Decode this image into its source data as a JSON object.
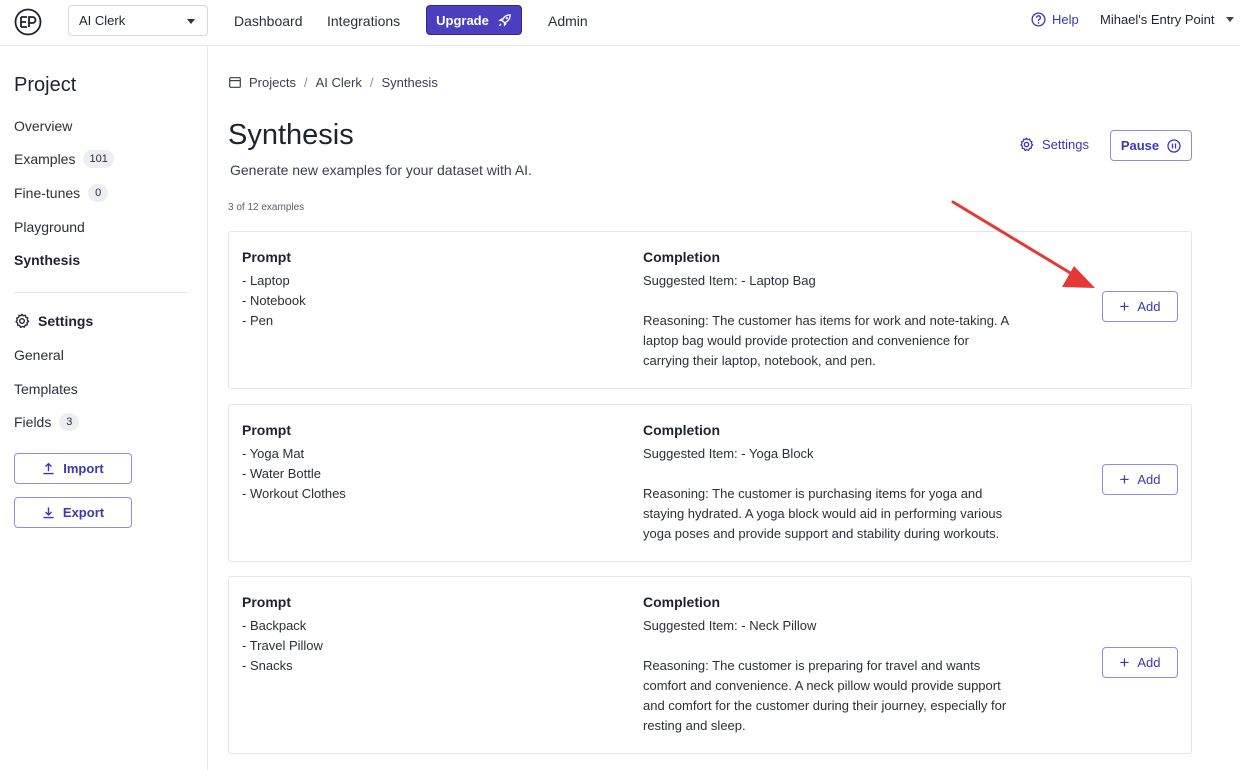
{
  "header": {
    "logo_text": "EP",
    "project_select_value": "AI Clerk",
    "nav": [
      "Dashboard",
      "Integrations",
      "Admin"
    ],
    "upgrade_label": "Upgrade",
    "help_label": "Help",
    "account_label": "Mihael's Entry Point",
    "accent_color": "#4b3fbf"
  },
  "sidebar": {
    "title": "Project",
    "items": [
      {
        "label": "Overview"
      },
      {
        "label": "Examples",
        "badge": "101"
      },
      {
        "label": "Fine-tunes",
        "badge": "0"
      },
      {
        "label": "Playground"
      },
      {
        "label": "Synthesis",
        "active": true
      }
    ],
    "settings_header": "Settings",
    "settings_items": [
      {
        "label": "General"
      },
      {
        "label": "Templates"
      },
      {
        "label": "Fields",
        "badge": "3"
      }
    ],
    "import_label": "Import",
    "export_label": "Export"
  },
  "breadcrumb": [
    "Projects",
    "AI Clerk",
    "Synthesis"
  ],
  "page": {
    "title": "Synthesis",
    "subtitle": "Generate new examples for your dataset with AI.",
    "count_text": "3 of 12 examples",
    "settings_label": "Settings",
    "pause_label": "Pause"
  },
  "examples": [
    {
      "prompt_header": "Prompt",
      "completion_header": "Completion",
      "prompt_items": [
        "- Laptop",
        "- Notebook",
        "- Pen"
      ],
      "suggested": "Suggested Item: - Laptop Bag",
      "reasoning": "Reasoning: The customer has items for work and note-taking. A laptop bag would provide protection and convenience for carrying their laptop, notebook, and pen.",
      "add_label": "Add"
    },
    {
      "prompt_header": "Prompt",
      "completion_header": "Completion",
      "prompt_items": [
        "- Yoga Mat",
        "- Water Bottle",
        "- Workout Clothes"
      ],
      "suggested": "Suggested Item: - Yoga Block",
      "reasoning": "Reasoning: The customer is purchasing items for yoga and staying hydrated. A yoga block would aid in performing various yoga poses and provide support and stability during workouts.",
      "add_label": "Add"
    },
    {
      "prompt_header": "Prompt",
      "completion_header": "Completion",
      "prompt_items": [
        "- Backpack",
        "- Travel Pillow",
        "- Snacks"
      ],
      "suggested": "Suggested Item: - Neck Pillow",
      "reasoning": "Reasoning: The customer is preparing for travel and wants comfort and convenience. A neck pillow would provide support and comfort for the customer during their journey, especially for resting and sleep.",
      "add_label": "Add"
    }
  ]
}
